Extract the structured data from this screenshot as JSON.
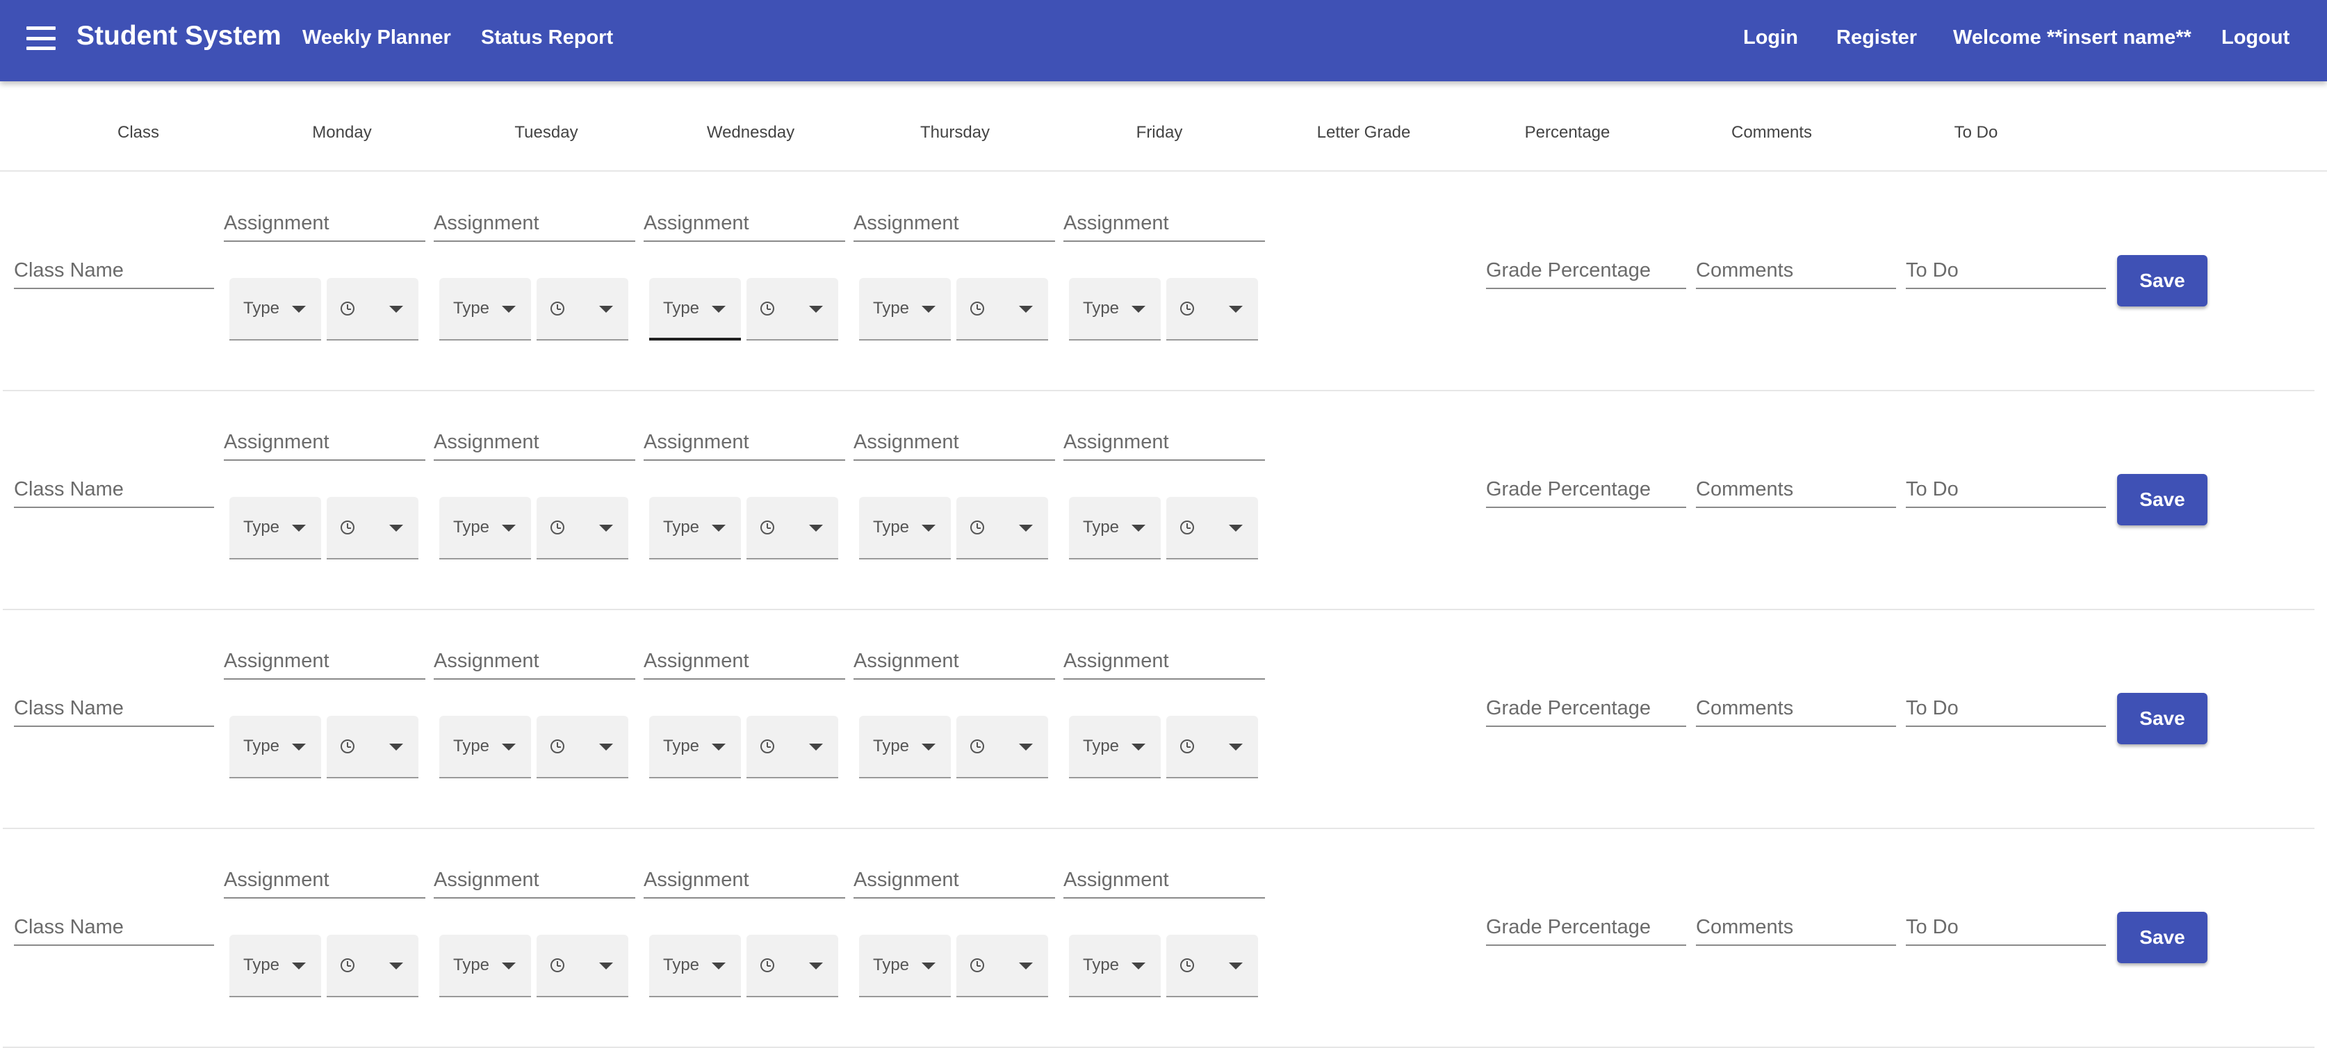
{
  "appbar": {
    "title": "Student System",
    "nav": {
      "weekly_planner": "Weekly Planner",
      "status_report": "Status Report"
    },
    "right": {
      "login": "Login",
      "register": "Register",
      "welcome": "Welcome **insert name**",
      "logout": "Logout"
    },
    "color": "#3f51b5"
  },
  "headers": [
    "Class",
    "Monday",
    "Tuesday",
    "Wednesday",
    "Thursday",
    "Friday",
    "Letter Grade",
    "Percentage",
    "Comments",
    "To Do"
  ],
  "row_fields": {
    "class_name": "Class Name",
    "assignment": "Assignment",
    "type": "Type",
    "grade_percentage": "Grade Percentage",
    "comments": "Comments",
    "to_do": "To Do",
    "save": "Save"
  },
  "row_count": 4,
  "day_count": 5
}
